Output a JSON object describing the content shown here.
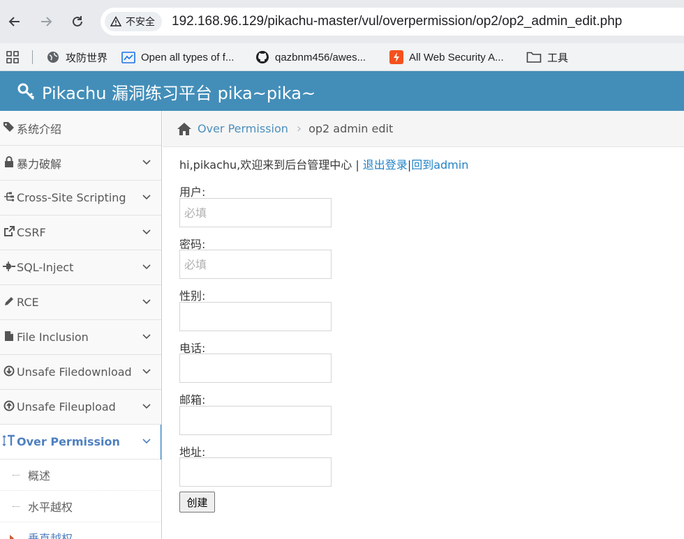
{
  "browser": {
    "security_label": "不安全",
    "url": "192.168.96.129/pikachu-master/vul/overpermission/op2/op2_admin_edit.php",
    "bookmarks": [
      {
        "label": "攻防世界",
        "icon": "globe-icon"
      },
      {
        "label": "Open all types of f...",
        "icon": "folder-link-icon"
      },
      {
        "label": "qazbnm456/awes...",
        "icon": "github-icon"
      },
      {
        "label": "All Web Security A...",
        "icon": "bolt-icon"
      },
      {
        "label": "工具",
        "icon": "folder-icon"
      }
    ]
  },
  "header": {
    "title": "Pikachu 漏洞练习平台 pika~pika~"
  },
  "sidebar": {
    "items": [
      {
        "label": "系统介绍",
        "icon": "tags-icon"
      },
      {
        "label": "暴力破解",
        "icon": "lock-icon"
      },
      {
        "label": "Cross-Site Scripting",
        "icon": "sitemap-icon"
      },
      {
        "label": "CSRF",
        "icon": "share-icon"
      },
      {
        "label": "SQL-Inject",
        "icon": "plug-icon"
      },
      {
        "label": "RCE",
        "icon": "pencil-icon"
      },
      {
        "label": "File Inclusion",
        "icon": "file-icon"
      },
      {
        "label": "Unsafe Filedownload",
        "icon": "download-circle-icon"
      },
      {
        "label": "Unsafe Fileupload",
        "icon": "upload-circle-icon"
      },
      {
        "label": "Over Permission",
        "icon": "text-height-icon"
      }
    ],
    "subitems": [
      {
        "label": "概述"
      },
      {
        "label": "水平越权"
      },
      {
        "label": "垂直越权"
      }
    ]
  },
  "breadcrumb": {
    "parent": "Over Permission",
    "current": "op2 admin edit"
  },
  "main": {
    "welcome_text": "hi,pikachu,欢迎来到后台管理中心 | ",
    "logout_link": "退出登录",
    "divider": "|",
    "back_link": "回到admin",
    "fields": [
      {
        "label": "用户:",
        "placeholder": "必填"
      },
      {
        "label": "密码:",
        "placeholder": "必填"
      },
      {
        "label": "性别:",
        "placeholder": ""
      },
      {
        "label": "电话:",
        "placeholder": ""
      },
      {
        "label": "邮箱:",
        "placeholder": ""
      },
      {
        "label": "地址:",
        "placeholder": ""
      }
    ],
    "submit_label": "创建"
  }
}
